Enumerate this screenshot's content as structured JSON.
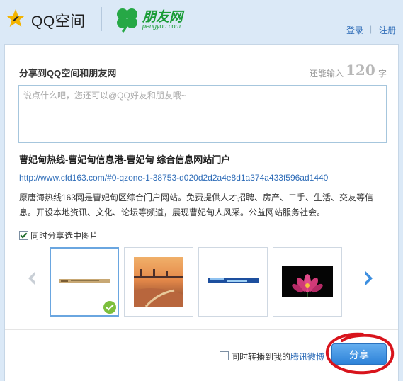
{
  "header": {
    "qzone_label": "QQ空间",
    "pengyou_label": "朋友网",
    "pengyou_sub": "pengyou.com",
    "login": "登录",
    "separator": "|",
    "register": "注册"
  },
  "form": {
    "title": "分享到QQ空间和朋友网",
    "remaining_label": "还能输入",
    "remaining_count": "120",
    "remaining_unit": "字",
    "placeholder": "说点什么吧，您还可以@QQ好友和朋友哦~"
  },
  "page": {
    "title": "曹妃甸热线-曹妃甸信息港-曹妃甸 综合信息网站门户",
    "url": "http://www.cfd163.com/#0-qzone-1-38753-d020d2d2a4e8d1a374a433f596ad1440",
    "description": "原唐海热线163网是曹妃甸区综合门户网站。免费提供人才招聘、房产、二手、生活、交友等信息。开设本地资讯、文化、论坛等频道，展现曹妃甸人风采。公益网站服务社会。"
  },
  "images": {
    "share_images_label": "同时分享选中图片",
    "share_images_checked": true,
    "thumbnails": [
      {
        "name": "banner-thumbnail",
        "selected": true
      },
      {
        "name": "sunset-bridge-thumbnail",
        "selected": false
      },
      {
        "name": "blue-banner-thumbnail",
        "selected": false
      },
      {
        "name": "lotus-flower-thumbnail",
        "selected": false
      }
    ]
  },
  "footer": {
    "weibo_prefix": "同时转播到我的",
    "weibo_link": "腾讯微博",
    "weibo_checked": false,
    "share_button": "分享"
  },
  "colors": {
    "accent_blue": "#2f6db8",
    "button_blue": "#3a8ee0",
    "pengyou_green": "#1a9c37",
    "annotation_red": "#d8141c"
  }
}
